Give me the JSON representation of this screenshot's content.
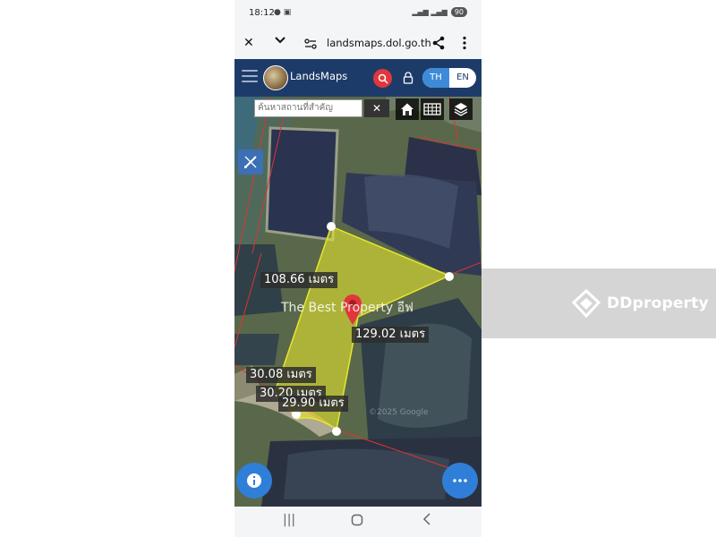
{
  "status": {
    "time": "18:12",
    "battery": "90"
  },
  "browser": {
    "url": "landsmaps.dol.go.th"
  },
  "app": {
    "name": "LandsMaps",
    "lang_th": "TH",
    "lang_en": "EN"
  },
  "search": {
    "placeholder": "ค้นหาสถานที่สำคัญ",
    "clear": "✕"
  },
  "measurements": [
    "108.66 เมตร",
    "129.02 เมตร",
    "30.08 เมตร",
    "30.20 เมตร",
    "29.90 เมตร"
  ],
  "map_attribution": "©2025 Google",
  "watermark": {
    "text": "The Best Property อีฟ",
    "brand": "DDproperty"
  },
  "colors": {
    "appbar": "#1d3b69",
    "parcel_fill": "#e6e62e",
    "accent": "#2f7fd8",
    "pin": "#e1373c"
  },
  "icons": [
    "close-icon",
    "chevron-down-icon",
    "site-settings-icon",
    "share-icon",
    "more-vert-icon",
    "menu-icon",
    "search-icon",
    "lock-icon",
    "home-icon",
    "grid-icon",
    "layers-icon",
    "measure-icon",
    "info-icon",
    "more-horiz-icon",
    "pin-icon"
  ]
}
